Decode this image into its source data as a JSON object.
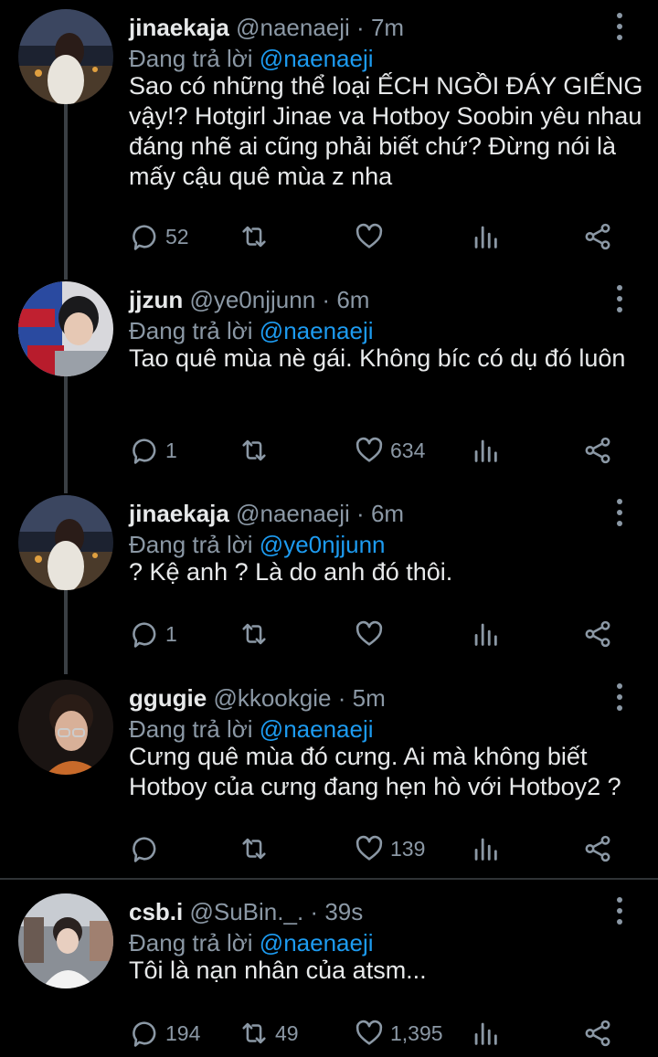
{
  "reply_prefix": "Đang trả lời",
  "dot": "·",
  "tweets": [
    {
      "name": "jinaekaja",
      "handle": "@naenaeji",
      "time": "7m",
      "reply_to": "@naenaeji",
      "text": "Sao có những thể loại ẾCH NGỒI ĐÁY GIẾNG vậy!? Hotgirl Jinae va Hotboy Soobin yêu nhau đáng nhẽ ai cũng phải biết chứ? Đừng nói là mấy cậu quê mùa z nha",
      "replies": "52",
      "retweets": "",
      "likes": ""
    },
    {
      "name": "jjzun",
      "handle": "@ye0njjunn",
      "time": "6m",
      "reply_to": "@naenaeji",
      "text": "Tao quê mùa nè gái. Không bíc có dụ đó luôn",
      "replies": "1",
      "retweets": "",
      "likes": "634"
    },
    {
      "name": "jinaekaja",
      "handle": "@naenaeji",
      "time": "6m",
      "reply_to": "@ye0njjunn",
      "text": "? Kệ anh ? Là do anh đó thôi.",
      "replies": "1",
      "retweets": "",
      "likes": ""
    },
    {
      "name": "ggugie",
      "handle": "@kkookgie",
      "time": "5m",
      "reply_to": "@naenaeji",
      "text": "Cưng quê mùa đó cưng. Ai mà không biết Hotboy của cưng đang hẹn hò với Hotboy2 ?",
      "replies": "",
      "retweets": "",
      "likes": "139"
    },
    {
      "name": "csb.i",
      "handle": "@SuBin._.",
      "time": "39s",
      "reply_to": "@naenaeji",
      "text": "Tôi là nạn nhân của atsm...",
      "replies": "194",
      "retweets": "49",
      "likes": "1,395"
    }
  ],
  "colors": {
    "background": "#000000",
    "text": "#e7e9ea",
    "muted": "#8b98a5",
    "link": "#1d9bf0",
    "thread_line": "#3a3f44"
  }
}
